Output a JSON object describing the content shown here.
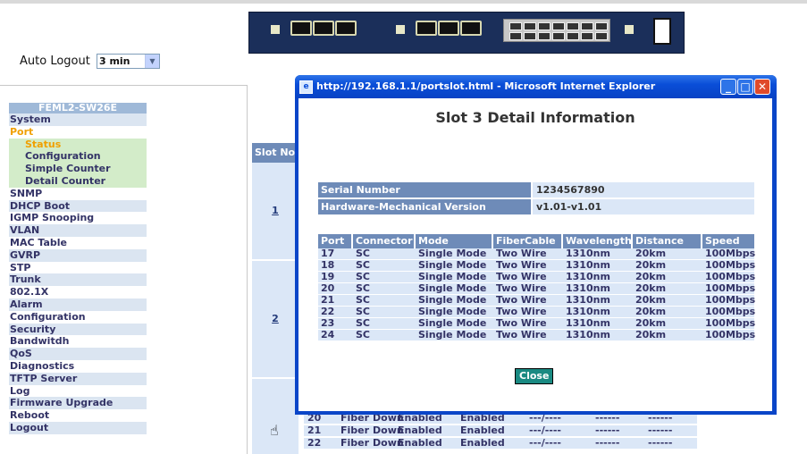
{
  "auto_logout": {
    "label": "Auto Logout",
    "value": "3 min"
  },
  "menu": {
    "title": "FEML2-SW26E",
    "items": [
      {
        "label": "System",
        "kind": "main"
      },
      {
        "label": "Port",
        "kind": "port"
      },
      {
        "label": "Status",
        "kind": "sub-active"
      },
      {
        "label": "Configuration",
        "kind": "sub"
      },
      {
        "label": "Simple Counter",
        "kind": "sub"
      },
      {
        "label": "Detail Counter",
        "kind": "sub"
      },
      {
        "label": "SNMP",
        "kind": "plain"
      },
      {
        "label": "DHCP Boot",
        "kind": "main"
      },
      {
        "label": "IGMP Snooping",
        "kind": "plain"
      },
      {
        "label": "VLAN",
        "kind": "main"
      },
      {
        "label": "MAC Table",
        "kind": "plain"
      },
      {
        "label": "GVRP",
        "kind": "main"
      },
      {
        "label": "STP",
        "kind": "plain"
      },
      {
        "label": "Trunk",
        "kind": "main"
      },
      {
        "label": "802.1X",
        "kind": "plain"
      },
      {
        "label": "Alarm",
        "kind": "main"
      },
      {
        "label": "Configuration",
        "kind": "plain"
      },
      {
        "label": "Security",
        "kind": "main"
      },
      {
        "label": "Bandwitdh",
        "kind": "plain"
      },
      {
        "label": "QoS",
        "kind": "main"
      },
      {
        "label": "Diagnostics",
        "kind": "plain"
      },
      {
        "label": "TFTP Server",
        "kind": "main"
      },
      {
        "label": "Log",
        "kind": "plain"
      },
      {
        "label": "Firmware Upgrade",
        "kind": "main"
      },
      {
        "label": "Reboot",
        "kind": "plain"
      },
      {
        "label": "Logout",
        "kind": "main"
      }
    ]
  },
  "background_table": {
    "header": "Slot No",
    "slot_links": [
      "1",
      "2"
    ],
    "rows": [
      {
        "port": "20",
        "media": "Fiber",
        "link": "Down",
        "state": "Enabled",
        "auto": "Enabled",
        "speed": "---/----",
        "rx": "------",
        "tx": "------"
      },
      {
        "port": "21",
        "media": "Fiber",
        "link": "Down",
        "state": "Enabled",
        "auto": "Enabled",
        "speed": "---/----",
        "rx": "------",
        "tx": "------"
      },
      {
        "port": "22",
        "media": "Fiber",
        "link": "Down",
        "state": "Enabled",
        "auto": "Enabled",
        "speed": "---/----",
        "rx": "------",
        "tx": "------"
      }
    ]
  },
  "popup": {
    "window_title": "http://192.168.1.1/portslot.html - Microsoft Internet Explorer",
    "heading": "Slot 3 Detail Information",
    "info": [
      {
        "label": "Serial Number",
        "value": "1234567890"
      },
      {
        "label": "Hardware-Mechanical Version",
        "value": "v1.01-v1.01"
      }
    ],
    "columns": [
      "Port",
      "Connector",
      "Mode",
      "FiberCable",
      "Wavelength",
      "Distance",
      "Speed"
    ],
    "rows": [
      {
        "port": "17",
        "connector": "SC",
        "mode": "Single Mode",
        "cable": "Two Wire",
        "wavelength": "1310nm",
        "distance": "20km",
        "speed": "100Mbps"
      },
      {
        "port": "18",
        "connector": "SC",
        "mode": "Single Mode",
        "cable": "Two Wire",
        "wavelength": "1310nm",
        "distance": "20km",
        "speed": "100Mbps"
      },
      {
        "port": "19",
        "connector": "SC",
        "mode": "Single Mode",
        "cable": "Two Wire",
        "wavelength": "1310nm",
        "distance": "20km",
        "speed": "100Mbps"
      },
      {
        "port": "20",
        "connector": "SC",
        "mode": "Single Mode",
        "cable": "Two Wire",
        "wavelength": "1310nm",
        "distance": "20km",
        "speed": "100Mbps"
      },
      {
        "port": "21",
        "connector": "SC",
        "mode": "Single Mode",
        "cable": "Two Wire",
        "wavelength": "1310nm",
        "distance": "20km",
        "speed": "100Mbps"
      },
      {
        "port": "22",
        "connector": "SC",
        "mode": "Single Mode",
        "cable": "Two Wire",
        "wavelength": "1310nm",
        "distance": "20km",
        "speed": "100Mbps"
      },
      {
        "port": "23",
        "connector": "SC",
        "mode": "Single Mode",
        "cable": "Two Wire",
        "wavelength": "1310nm",
        "distance": "20km",
        "speed": "100Mbps"
      },
      {
        "port": "24",
        "connector": "SC",
        "mode": "Single Mode",
        "cable": "Two Wire",
        "wavelength": "1310nm",
        "distance": "20km",
        "speed": "100Mbps"
      }
    ],
    "close_label": "Close"
  },
  "colors": {
    "header_blue": "#6e8bb8",
    "row_blue": "#dbe7f7",
    "active_orange": "#f0a000",
    "close_teal": "#1a8a82"
  }
}
